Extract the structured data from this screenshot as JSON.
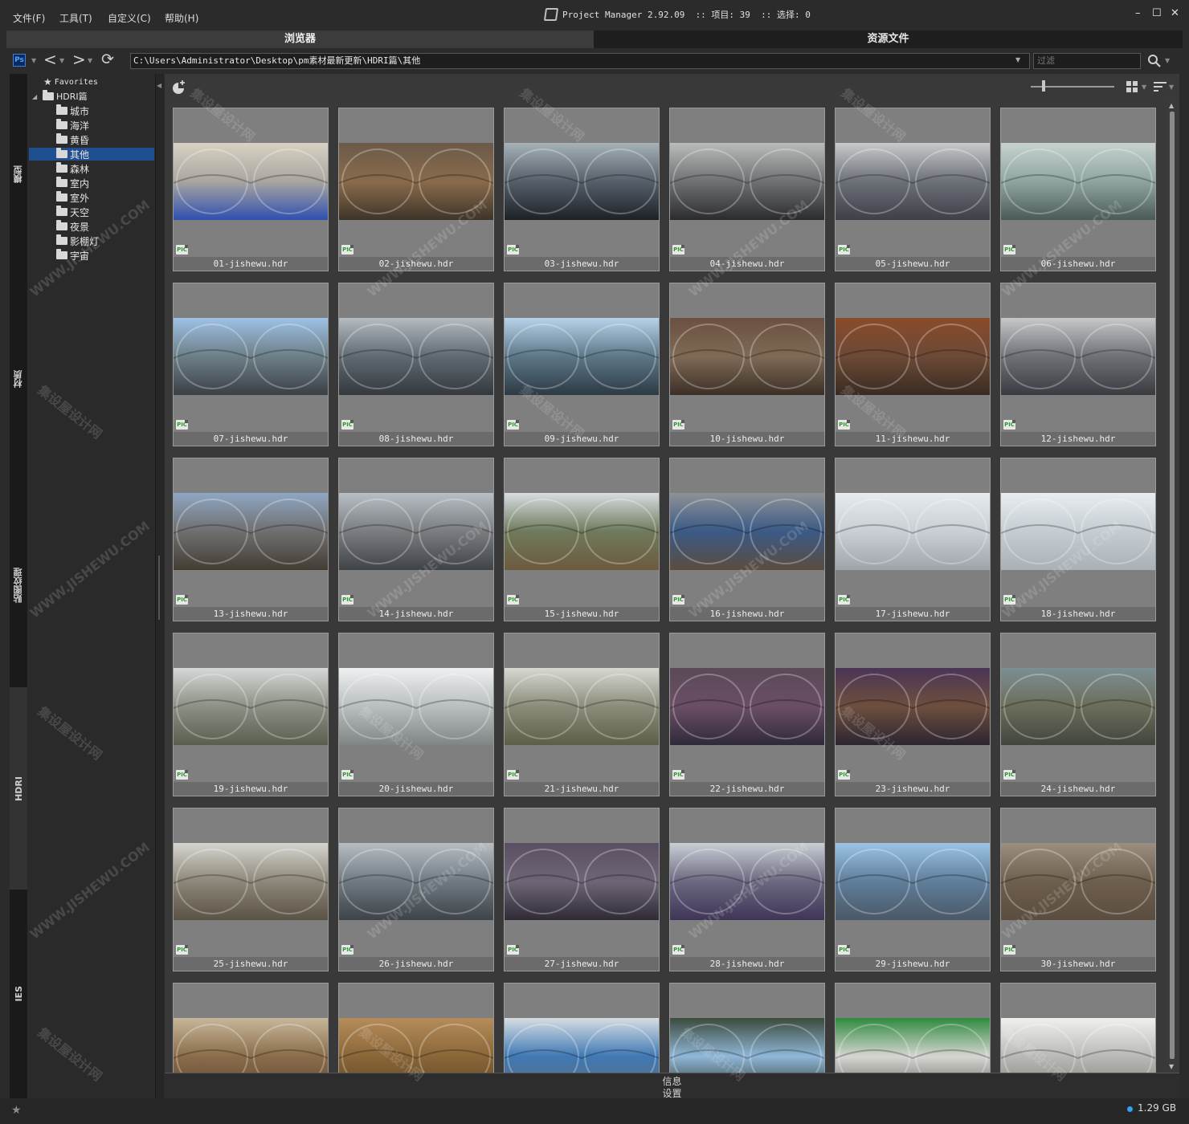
{
  "menu": [
    {
      "id": "file",
      "label": "文件(F)"
    },
    {
      "id": "tools",
      "label": "工具(T)"
    },
    {
      "id": "custom",
      "label": "自定义(C)"
    },
    {
      "id": "help",
      "label": "帮助(H)"
    }
  ],
  "title": {
    "text": "Project Manager 2.92.09  :: 项目: 39  :: 选择: 0"
  },
  "window_buttons": {
    "minimize": "–",
    "maximize": "☐",
    "close": "✕"
  },
  "tabs": {
    "browser": "浏览器",
    "assets": "资源文件"
  },
  "address": {
    "ps_icon": "Ps",
    "path": "C:\\Users\\Administrator\\Desktop\\pm素材最新更新\\HDRI篇\\其他",
    "filter_placeholder": "过滤"
  },
  "icons": {
    "back": "chevron-left-icon",
    "forward": "chevron-right-icon",
    "refresh": "refresh-icon",
    "search": "search-icon",
    "add": "add-folder-icon",
    "grid": "grid-view-icon",
    "sort": "sort-icon",
    "star": "star-icon"
  },
  "nav_glyphs": {
    "back": "<",
    "forward": ">",
    "refresh": "⟳",
    "star": "★"
  },
  "sidebar_tabs": [
    "模型",
    "材质",
    "贴图纹理",
    "HDRI",
    "IES"
  ],
  "tree": {
    "favorites": "Favorites",
    "root": "HDRI篇",
    "children": [
      "城市",
      "海洋",
      "黄昏",
      "其他",
      "森林",
      "室内",
      "室外",
      "天空",
      "夜景",
      "影棚灯",
      "宇宙"
    ],
    "selected": "其他"
  },
  "badge": "PIC",
  "files": [
    "01-jishewu.hdr",
    "02-jishewu.hdr",
    "03-jishewu.hdr",
    "04-jishewu.hdr",
    "05-jishewu.hdr",
    "06-jishewu.hdr",
    "07-jishewu.hdr",
    "08-jishewu.hdr",
    "09-jishewu.hdr",
    "10-jishewu.hdr",
    "11-jishewu.hdr",
    "12-jishewu.hdr",
    "13-jishewu.hdr",
    "14-jishewu.hdr",
    "15-jishewu.hdr",
    "16-jishewu.hdr",
    "17-jishewu.hdr",
    "18-jishewu.hdr",
    "19-jishewu.hdr",
    "20-jishewu.hdr",
    "21-jishewu.hdr",
    "22-jishewu.hdr",
    "23-jishewu.hdr",
    "24-jishewu.hdr",
    "25-jishewu.hdr",
    "26-jishewu.hdr",
    "27-jishewu.hdr",
    "28-jishewu.hdr",
    "29-jishewu.hdr",
    "30-jishewu.hdr"
  ],
  "partial_row_count": 6,
  "thumb_palettes": [
    [
      "#d9d2c4",
      "#a8a69f",
      "#2f4fb0"
    ],
    [
      "#6b5a48",
      "#8a6b4c",
      "#3e3428"
    ],
    [
      "#a7b1b8",
      "#55606a",
      "#1d2126"
    ],
    [
      "#b9bcbb",
      "#6e7272",
      "#2b2b2e"
    ],
    [
      "#c8cbcd",
      "#6c7077",
      "#3e3f48"
    ],
    [
      "#c7d2cf",
      "#8fa5a0",
      "#4b5a57"
    ],
    [
      "#9ec1e6",
      "#6d7f88",
      "#3a3f44"
    ],
    [
      "#b5bcc2",
      "#5f6a72",
      "#34383d"
    ],
    [
      "#b7d3ea",
      "#5d7788",
      "#2c3a43"
    ],
    [
      "#6a5040",
      "#7f6a55",
      "#3b2f27"
    ],
    [
      "#8a4b2b",
      "#6c4a36",
      "#3a2a22"
    ],
    [
      "#c6c9cc",
      "#6e7175",
      "#3a3b40"
    ],
    [
      "#8fa7c4",
      "#6f6f70",
      "#443c33"
    ],
    [
      "#b8bfc5",
      "#7a7d80",
      "#3f4246"
    ],
    [
      "#d8dde2",
      "#6f7a5c",
      "#6d5a3e"
    ],
    [
      "#8e9296",
      "#3b5a86",
      "#5b4c3f"
    ],
    [
      "#e7ebee",
      "#c9cfd4",
      "#9ea4a9"
    ],
    [
      "#e8edf0",
      "#c5cdd2",
      "#a9b1b6"
    ],
    [
      "#d6d9d8",
      "#8c9085",
      "#5a5e4e"
    ],
    [
      "#eef0f1",
      "#b9bec0",
      "#7f8584"
    ],
    [
      "#d7d9d2",
      "#8b8c7a",
      "#5c5e47"
    ],
    [
      "#5b4a57",
      "#6b4e65",
      "#2f2a3a"
    ],
    [
      "#4a3555",
      "#6d4f3e",
      "#2c2530"
    ],
    [
      "#7c8f94",
      "#6c6d5a",
      "#40463e"
    ],
    [
      "#d6d5cf",
      "#8d8779",
      "#5a5245"
    ],
    [
      "#b7bec3",
      "#6f7a82",
      "#3d4348"
    ],
    [
      "#5a4f62",
      "#6e6676",
      "#2f2a36"
    ],
    [
      "#c9d0d6",
      "#6b6880",
      "#3f3557"
    ],
    [
      "#9cc4e6",
      "#5f7e9a",
      "#4a5866"
    ],
    [
      "#9b8f80",
      "#6e5e4d",
      "#5a4d40"
    ],
    [
      "#c7b79a",
      "#8a6c4a",
      "#5e4732"
    ],
    [
      "#b58c5a",
      "#8a6638",
      "#5e4524"
    ],
    [
      "#d7dde2",
      "#3f79b5",
      "#5e6b78"
    ],
    [
      "#3b4a3c",
      "#8fb7d8",
      "#2a3025"
    ],
    [
      "#2f8a3f",
      "#d6d6d2",
      "#5f6060"
    ],
    [
      "#f0f0ee",
      "#b9bab5",
      "#7d7f7a"
    ]
  ],
  "info": {
    "info_label": "信息",
    "settings_label": "设置"
  },
  "status": {
    "disk": "1.29 GB"
  },
  "colors": {
    "accent": "#1f4f8f",
    "status_dot": "#2ea3f2",
    "pic_green": "#2e9a2e"
  },
  "watermarks": {
    "cn": "集设屋设计网",
    "en": "WWW.JISHEWU.COM"
  }
}
